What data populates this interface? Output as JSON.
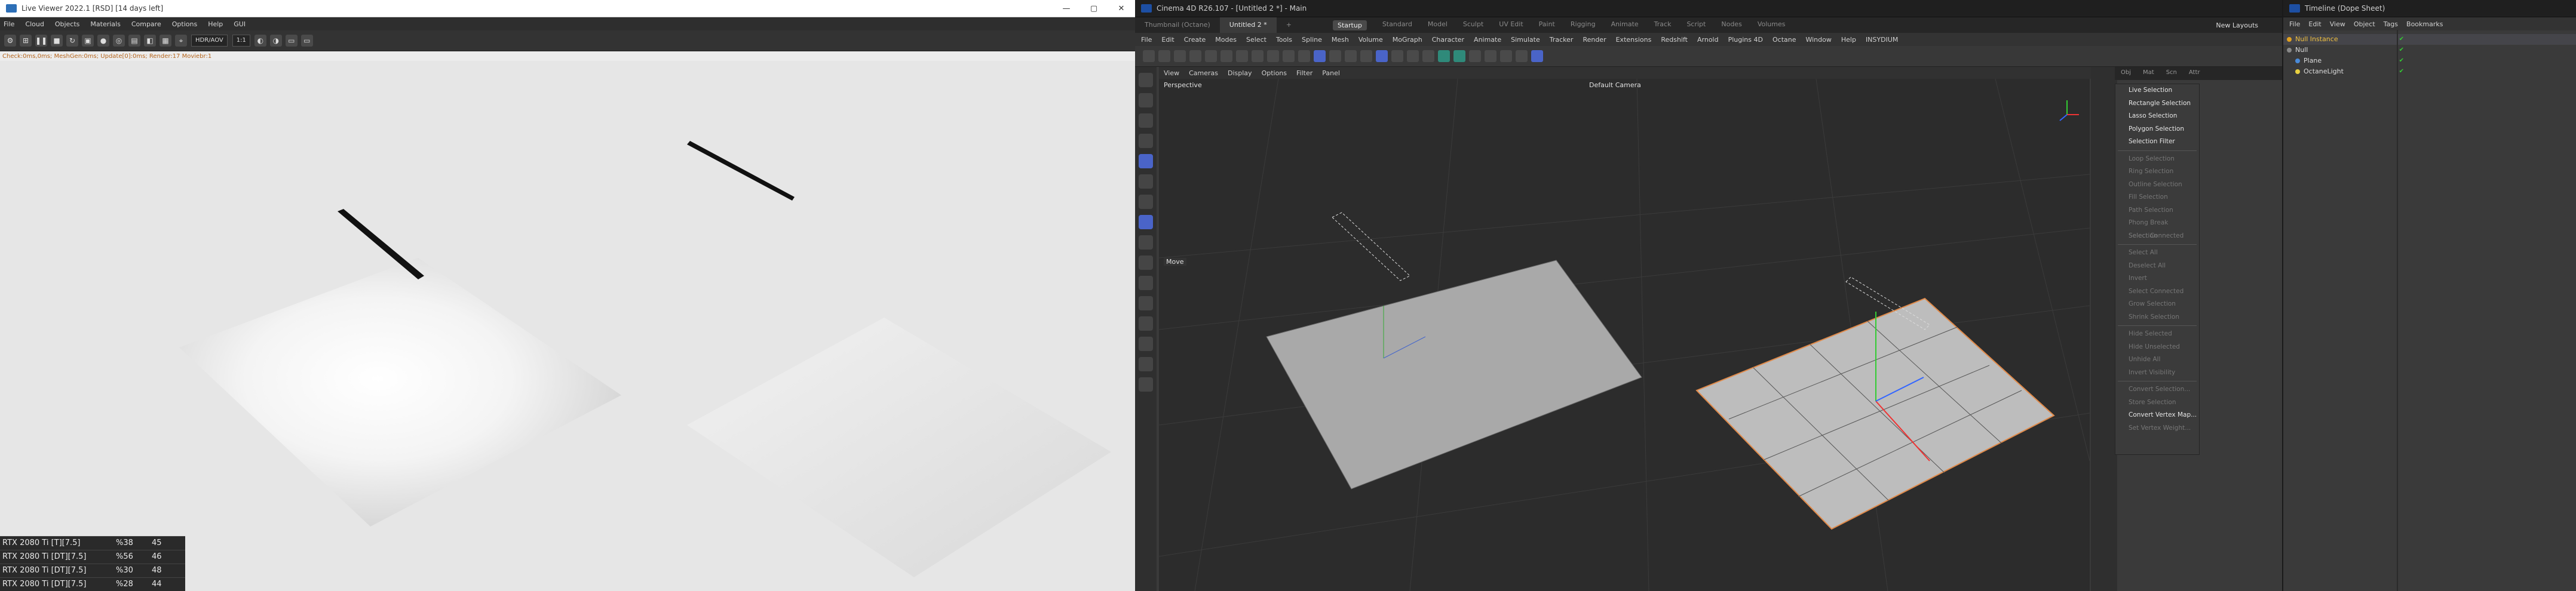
{
  "liveviewer": {
    "title": "Live Viewer 2022.1 [RSD] [14 days left]",
    "menu": [
      "File",
      "Cloud",
      "Objects",
      "Materials",
      "Compare",
      "Options",
      "Help",
      "GUI"
    ],
    "toolbar": {
      "mode_select": "HDR/AOV",
      "zoom_select": "1:1"
    },
    "status": "Check:0ms,0ms; MeshGen:0ms; Update[0]:0ms; Render:17 Moviebr:1",
    "window_controls": [
      "—",
      "▢",
      "✕"
    ],
    "gpu_table": [
      {
        "name": "RTX 2080 Ti [T][7.5]",
        "usage": "%38",
        "temp": "45"
      },
      {
        "name": "RTX 2080 Ti [DT][7.5]",
        "usage": "%56",
        "temp": "46"
      },
      {
        "name": "RTX 2080 Ti [DT][7.5]",
        "usage": "%30",
        "temp": "48"
      },
      {
        "name": "RTX 2080 Ti [DT][7.5]",
        "usage": "%28",
        "temp": "44"
      }
    ]
  },
  "c4d": {
    "title": "Cinema 4D R26.107 - [Untitled 2 *] - Main",
    "tabs": [
      "Untitled 2 *",
      "Thumbnail (Octane)"
    ],
    "new_tab": "+",
    "layouts": [
      "Startup",
      "Standard",
      "Model",
      "Sculpt",
      "UV Edit",
      "Paint",
      "Rigging",
      "Animate",
      "Track",
      "Script",
      "Nodes",
      "Volumes"
    ],
    "active_layout": "Startup",
    "new_layouts": "New Layouts",
    "menu": [
      "File",
      "Edit",
      "Create",
      "Modes",
      "Select",
      "Tools",
      "Spline",
      "Mesh",
      "Volume",
      "MoGraph",
      "Character",
      "Animate",
      "Simulate",
      "Tracker",
      "Render",
      "Extensions",
      "Redshift",
      "Arnold",
      "Plugins 4D",
      "Octane",
      "Window",
      "Help",
      "INSYDIUM"
    ],
    "viewport_menu": [
      "View",
      "Cameras",
      "Display",
      "Options",
      "Filter",
      "Panel"
    ],
    "viewport_label": "Perspective",
    "camera_label": "Default Camera",
    "move_label": "Move",
    "prop_tabs": [
      "Obj",
      "Mat",
      "Scn",
      "Attr"
    ],
    "selection_menu": [
      {
        "label": "Live Selection",
        "dim": false
      },
      {
        "label": "Rectangle Selection",
        "dim": false
      },
      {
        "label": "Lasso Selection",
        "dim": false
      },
      {
        "label": "Polygon Selection",
        "dim": false
      },
      {
        "label": "Selection Filter",
        "dim": false
      },
      {
        "label": "Loop Selection",
        "dim": true
      },
      {
        "label": "Ring Selection",
        "dim": true
      },
      {
        "label": "Outline Selection",
        "dim": true
      },
      {
        "label": "Fill Selection",
        "dim": true
      },
      {
        "label": "Path Selection",
        "dim": true
      },
      {
        "label": "Phong Break Selection",
        "dim": true
      },
      {
        "label": "Select Connected",
        "dim": true
      },
      {
        "label": "Select All",
        "dim": true
      },
      {
        "label": "Deselect All",
        "dim": true
      },
      {
        "label": "Invert",
        "dim": true
      },
      {
        "label": "Select Connected",
        "dim": true
      },
      {
        "label": "Grow Selection",
        "dim": true
      },
      {
        "label": "Shrink Selection",
        "dim": true
      },
      {
        "label": "Hide Selected",
        "dim": true
      },
      {
        "label": "Hide Unselected",
        "dim": true
      },
      {
        "label": "Unhide All",
        "dim": true
      },
      {
        "label": "Invert Visibility",
        "dim": true
      },
      {
        "label": "Convert Selection...",
        "dim": true
      },
      {
        "label": "Store Selection",
        "dim": true
      },
      {
        "label": "Convert Vertex Map...",
        "dim": false
      },
      {
        "label": "Set Vertex Weight...",
        "dim": true
      }
    ]
  },
  "timeline": {
    "title": "Timeline (Dope Sheet)",
    "menu": [
      "File",
      "Edit",
      "View",
      "Object",
      "Tags",
      "Bookmarks"
    ],
    "tree": [
      {
        "label": "Null Instance",
        "level": 0,
        "selected": true
      },
      {
        "label": "Null",
        "level": 0,
        "selected": false
      },
      {
        "label": "Plane",
        "level": 1,
        "selected": false
      },
      {
        "label": "OctaneLight",
        "level": 1,
        "selected": false
      }
    ]
  }
}
